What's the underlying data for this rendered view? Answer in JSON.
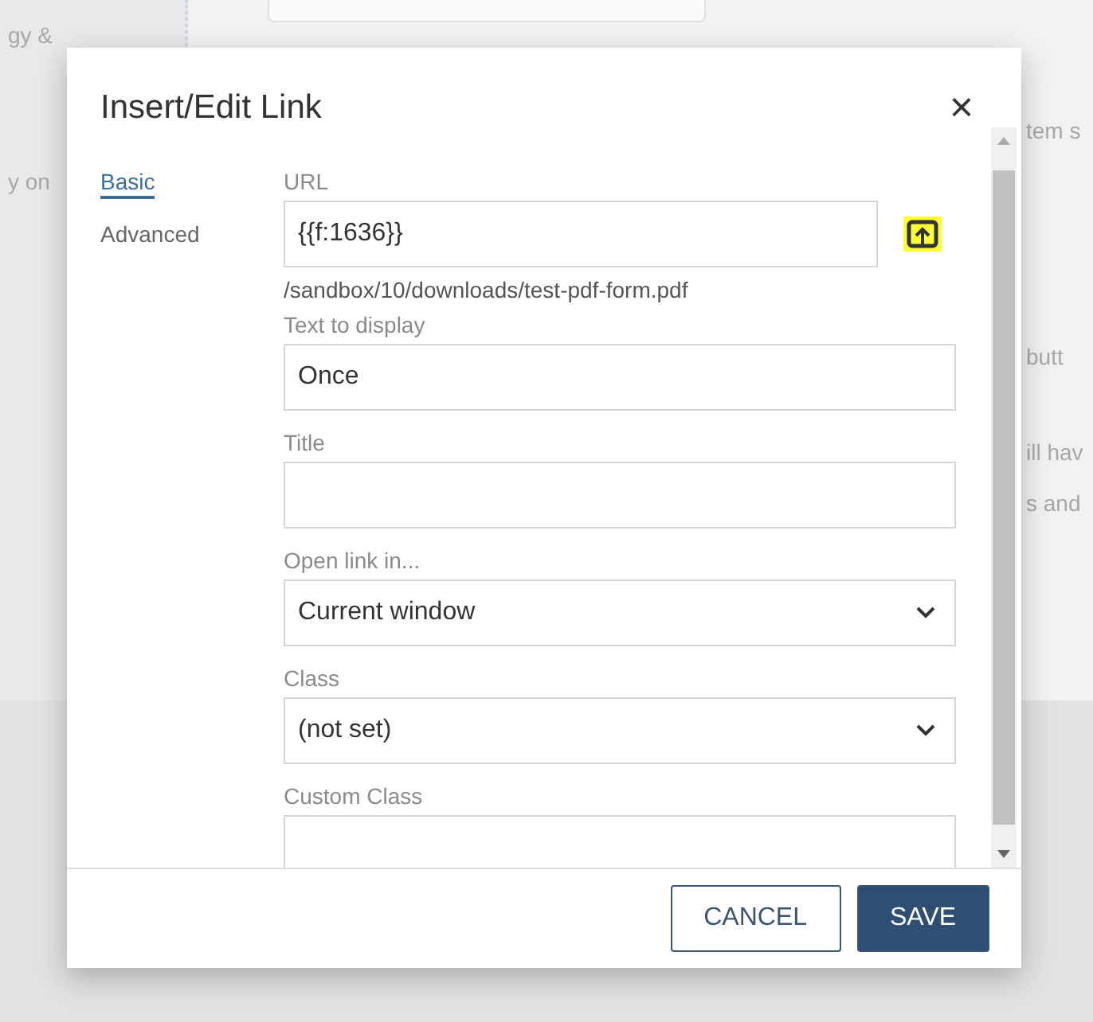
{
  "background": {
    "texts_left": [
      "gy &",
      "y on"
    ],
    "texts_right": [
      "tem s",
      "butt",
      "ill hav",
      "s and"
    ]
  },
  "dialog": {
    "title": "Insert/Edit Link",
    "close": "×",
    "tabs": [
      {
        "label": "Basic",
        "selected": true
      },
      {
        "label": "Advanced",
        "selected": false
      }
    ],
    "url": {
      "label": "URL",
      "value": "{{f:1636}}",
      "path": "/sandbox/10/downloads/test-pdf-form.pdf"
    },
    "fields": [
      {
        "kind": "text",
        "label": "Text to display",
        "value": "Once"
      },
      {
        "kind": "text",
        "label": "Title"
      },
      {
        "kind": "select",
        "label": "Open link in...",
        "value": "Current window"
      },
      {
        "kind": "select",
        "label": "Class",
        "value": "(not set)"
      },
      {
        "kind": "text",
        "label": "Custom Class"
      }
    ],
    "buttons": [
      {
        "label": "CANCEL",
        "kind": "secondary"
      },
      {
        "label": "SAVE",
        "kind": "primary"
      }
    ]
  }
}
